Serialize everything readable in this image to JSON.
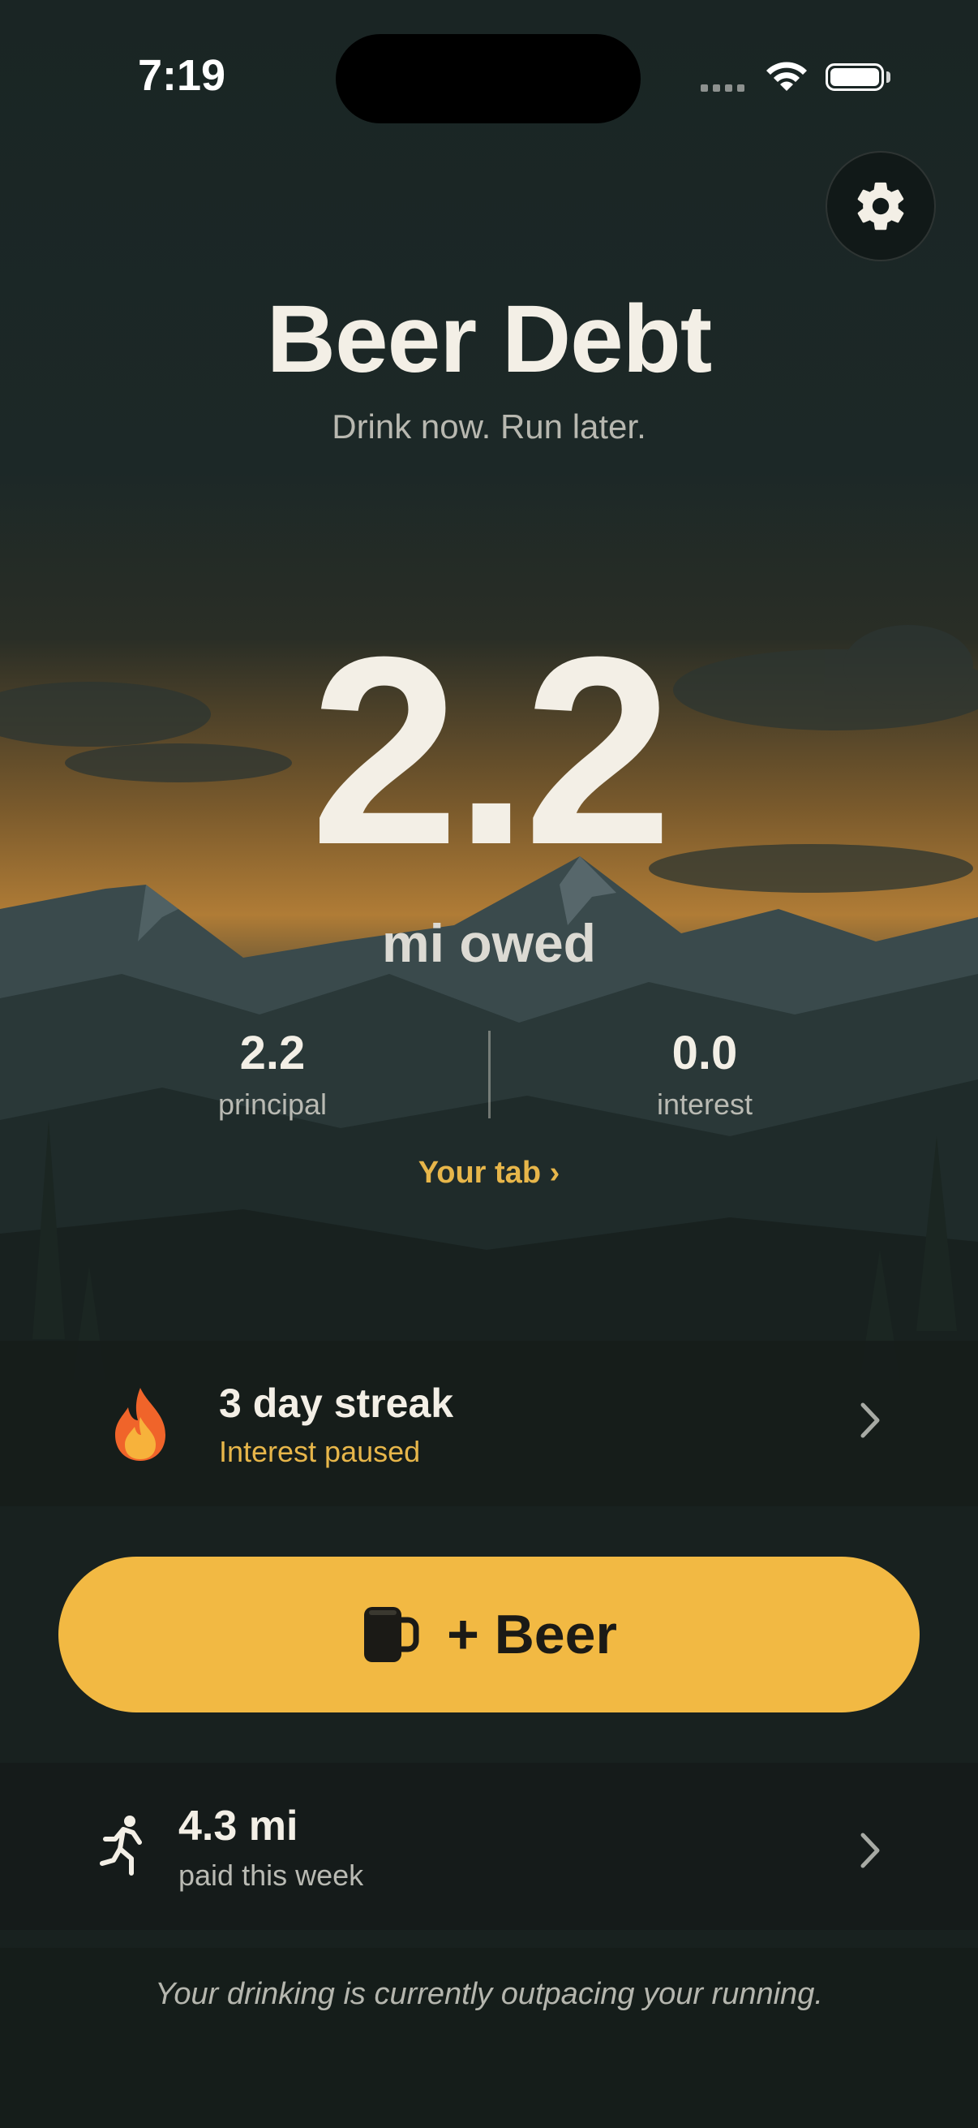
{
  "status_bar": {
    "time": "7:19"
  },
  "header": {
    "title": "Beer Debt",
    "tagline": "Drink now. Run later."
  },
  "debt": {
    "total": "2.2",
    "unit_label": "mi owed",
    "principal_value": "2.2",
    "principal_label": "principal",
    "interest_value": "0.0",
    "interest_label": "interest",
    "tab_link": "Your tab ›"
  },
  "streak": {
    "title": "3 day streak",
    "subtitle": "Interest paused"
  },
  "beer_button": {
    "label": "+ Beer"
  },
  "running": {
    "value": "4.3 mi",
    "label": "paid this week"
  },
  "footer": {
    "message": "Your drinking is currently outpacing your running."
  },
  "colors": {
    "accent": "#f2b943",
    "accent_text": "#e7b64a",
    "background": "#17201f",
    "text_primary": "#f3efe6"
  },
  "icons": {
    "settings": "gear-icon",
    "streak": "fire-icon",
    "beer": "beer-mug-icon",
    "running": "runner-icon",
    "chevron": "chevron-right-icon"
  }
}
